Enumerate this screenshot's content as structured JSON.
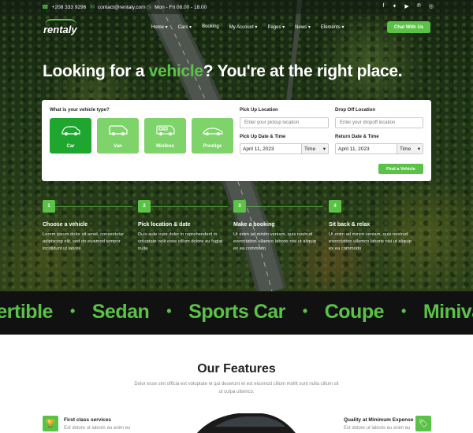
{
  "topbar": {
    "phone": "+208 333 9296",
    "email": "contact@rentaly.com",
    "hours": "Mon - Fri 08.00 - 18.00",
    "socials": [
      "facebook-icon",
      "twitter-icon",
      "youtube-icon",
      "pinterest-icon",
      "instagram-icon"
    ]
  },
  "nav": {
    "logo": "rentaly",
    "items": [
      "Home",
      "Cars",
      "Booking",
      "My Account",
      "Pages",
      "News",
      "Elements"
    ],
    "cta": "Chat With Us"
  },
  "hero": {
    "headline_a": "Looking for a ",
    "headline_accent": "vehicle",
    "headline_b": "? You're at the right place."
  },
  "search": {
    "vehicle_type_label": "What is your vehicle type?",
    "vehicle_types": [
      "Car",
      "Van",
      "Minibus",
      "Prestige"
    ],
    "selected_vehicle": "Car",
    "pickup_location_label": "Pick Up Location",
    "pickup_location_placeholder": "Enter your pickup location",
    "dropoff_location_label": "Drop Off Location",
    "dropoff_location_placeholder": "Enter your dropoff location",
    "pickup_datetime_label": "Pick Up Date & Time",
    "pickup_date": "April 11, 2023",
    "pickup_time": "Time",
    "return_datetime_label": "Return Date & Time",
    "return_date": "April 11, 2023",
    "return_time": "Time",
    "find_button": "Find a Vehicle"
  },
  "steps": [
    {
      "num": "1",
      "title": "Choose a vehicle",
      "text": "Lorem ipsum dolor sit amet, consectetur adipiscing elit, sed do eiusmod tempor incididunt ut labore"
    },
    {
      "num": "2",
      "title": "Pick location & date",
      "text": "Duis aute irure dolor in reprehenderit in voluptate velit esse cillum dolore eu fugiat nulla"
    },
    {
      "num": "3",
      "title": "Make a booking",
      "text": "Ut enim ad minim veniam, quis nostrud exercitation ullamco laboris nisi ut aliquip ex ea commodo"
    },
    {
      "num": "4",
      "title": "Sit back & relax",
      "text": "Ut enim ad minim veniam, quis nostrud exercitation ullamco laboris nisi ut aliquip ex ea commodo"
    }
  ],
  "marquee": [
    "vertible",
    "Sedan",
    "Sports Car",
    "Coupe",
    "Minivan"
  ],
  "features": {
    "title": "Our Features",
    "description": "Dolor esse sint officia est voluptate et qui deserunt et est eiusmod cillum mollit sunt nulla cillum sit ut culpa ullamco.",
    "left_title": "First class services",
    "left_text": "Est dolore ut laboris eu enim eu",
    "right_title": "Quality at Minimum Expense",
    "right_text": "Est dolore ut laboris eu enim eu"
  },
  "colors": {
    "accent": "#5bc248",
    "accent_dark": "#1ea62e",
    "dark_band": "#111111"
  }
}
